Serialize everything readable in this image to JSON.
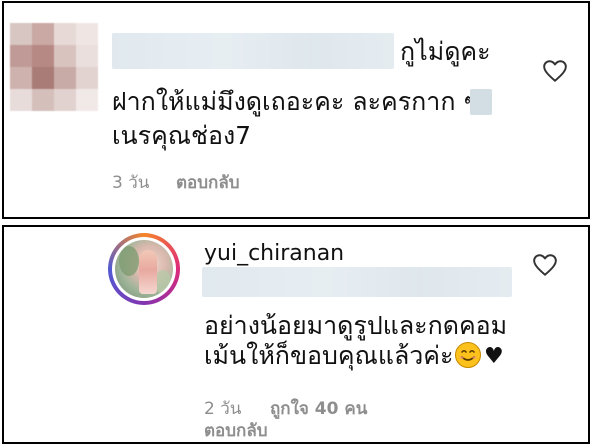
{
  "comment_1": {
    "mention_suffix": "กูไม่ดูคะ",
    "line_1": "ฝากให้แม่มึงดูเถอะคะ ละครกาก ๆ",
    "line_2": "เนรคุณช่อง7",
    "time": "3 วัน",
    "reply_label": "ตอบกลับ",
    "icons": {
      "like": "heart-outline-icon"
    }
  },
  "comment_2": {
    "username": "yui_chiranan",
    "line_1": "อย่างน้อยมาดูรูปและกดคอม",
    "line_2": "เม้นให้ก็ขอบคุณแล้วค่ะ",
    "time": "2 วัน",
    "likes_label": "ถูกใจ 40 คน",
    "reply_label": "ตอบกลับ",
    "icons": {
      "like": "heart-outline-icon",
      "emoji": "smiling-face-emoji",
      "end": "black-heart-icon"
    }
  },
  "colors": {
    "text": "#111111",
    "meta": "#8e8e8e",
    "border": "#000000",
    "story_ring": [
      "#f58529",
      "#dd2a7b",
      "#8134af",
      "#515bd4"
    ]
  }
}
